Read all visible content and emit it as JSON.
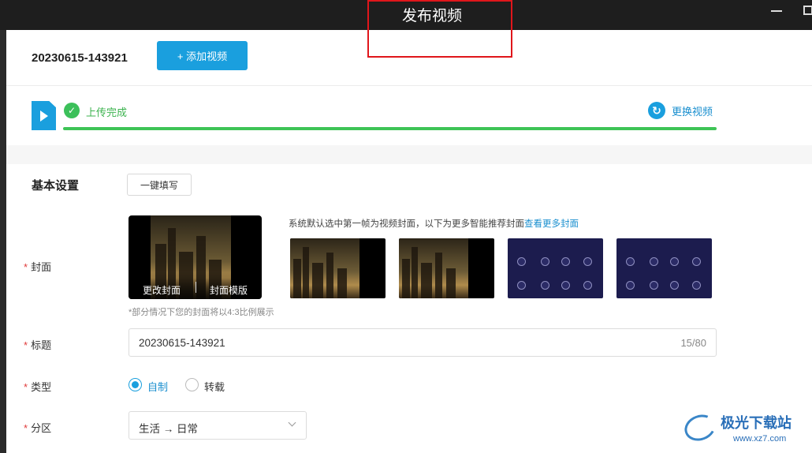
{
  "window": {
    "title": "发布视频"
  },
  "upload": {
    "filename": "20230615-143921",
    "add_video_label": "+ 添加视频",
    "status": "上传完成",
    "change_video_label": "更换视频",
    "progress_fraction": 1.0
  },
  "basic": {
    "section_title": "基本设置",
    "autofill_label": "一键填写"
  },
  "cover": {
    "label": "封面",
    "change_cover_label": "更改封面",
    "cover_template_label": "封面模版",
    "hint_prefix": "系统默认选中第一帧为视频封面，以下为更多智能推荐封面",
    "hint_link": "查看更多封面",
    "note": "*部分情况下您的封面将以4:3比例展示"
  },
  "title_field": {
    "label": "标题",
    "value": "20230615-143921",
    "counter": "15/80"
  },
  "type_field": {
    "label": "类型",
    "options": [
      "自制",
      "转载"
    ],
    "selected": "自制"
  },
  "category_field": {
    "label": "分区",
    "value": "生活 → 日常"
  },
  "watermark": {
    "text": "极光下载站",
    "url": "www.xz7.com"
  },
  "colors": {
    "accent": "#1a9fde",
    "success": "#3cc05a",
    "required": "#e03a3a",
    "highlight_box": "#e0161b"
  }
}
